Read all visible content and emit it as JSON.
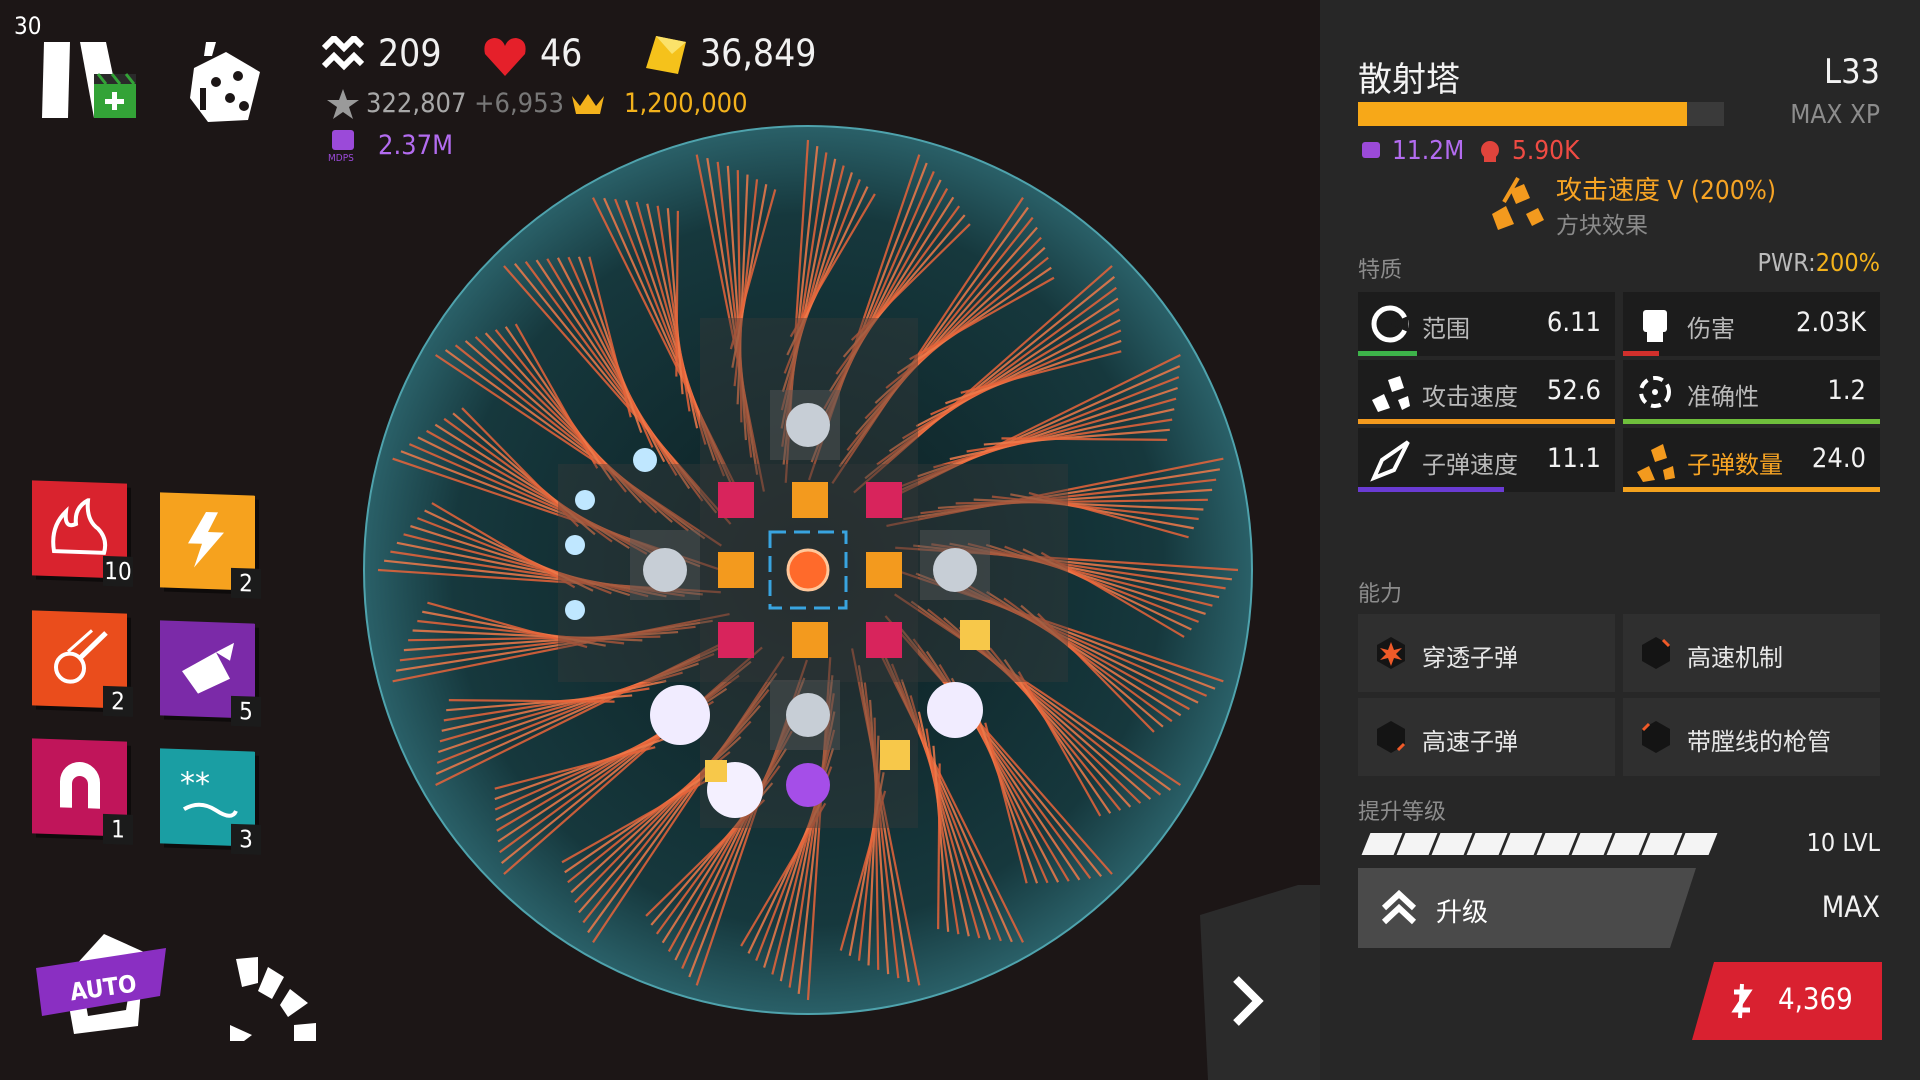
{
  "hud": {
    "fps": "30",
    "waves": "209",
    "lives": "46",
    "gold": "36,849",
    "score": "322,807",
    "score_delta": "+6,953",
    "best_score": "1,200,000",
    "mdps_label": "MDPS",
    "mdps_value": "2.37M",
    "icons": [
      "pause-icon",
      "video-ad-icon",
      "dice-icon",
      "waves-icon",
      "heart-icon",
      "gold-gem-icon",
      "star-icon",
      "crown-icon",
      "fist-icon"
    ]
  },
  "abilities": [
    {
      "name": "fire-storm",
      "count": "10",
      "color": "#d9232e"
    },
    {
      "name": "thunder",
      "count": "2",
      "color": "#f6a21e"
    },
    {
      "name": "meteor",
      "count": "2",
      "color": "#ea4d1c"
    },
    {
      "name": "nuke",
      "count": "5",
      "color": "#7b2aa8"
    },
    {
      "name": "magnet",
      "count": "1",
      "color": "#c0155a"
    },
    {
      "name": "blizzard",
      "count": "3",
      "color": "#1a9ea3"
    }
  ],
  "controls": {
    "auto_label": "AUTO",
    "next_arrow": "›"
  },
  "tower": {
    "name": "散射塔",
    "level": "L33",
    "xp_label": "MAX XP",
    "xp_fill": 0.9,
    "mdps": "11.2M",
    "kills": "5.90K",
    "buff_name": "攻击速度 V (200%)",
    "buff_source": "方块效果",
    "traits_label": "特质",
    "pwr_label": "PWR:",
    "pwr_value": "200%",
    "stats": [
      {
        "label": "范围",
        "value": "6.11",
        "color": "#3db34a",
        "fill": 0.23
      },
      {
        "label": "伤害",
        "value": "2.03K",
        "color": "#d2302c",
        "fill": 0.14
      },
      {
        "label": "攻击速度",
        "value": "52.6",
        "color": "#f39a1e",
        "fill": 1.0
      },
      {
        "label": "准确性",
        "value": "1.2",
        "color": "#6fbf3c",
        "fill": 1.0
      },
      {
        "label": "子弹速度",
        "value": "11.1",
        "color": "#6a3bd4",
        "fill": 0.57
      },
      {
        "label": "子弹数量",
        "value": "24.0",
        "color": "#f3a21e",
        "fill": 1.0,
        "highlight": true
      }
    ],
    "abilities_label": "能力",
    "abilities": [
      {
        "label": "穿透子弹",
        "active": true
      },
      {
        "label": "高速机制",
        "active": false
      },
      {
        "label": "高速子弹",
        "active": false
      },
      {
        "label": "带膛线的枪管",
        "active": false
      }
    ],
    "upgrade_levels_label": "提升等级",
    "upgrade_levels_value": "10 LVL",
    "upgrade_label": "升级",
    "upgrade_value": "MAX",
    "sell_value": "4,369"
  }
}
